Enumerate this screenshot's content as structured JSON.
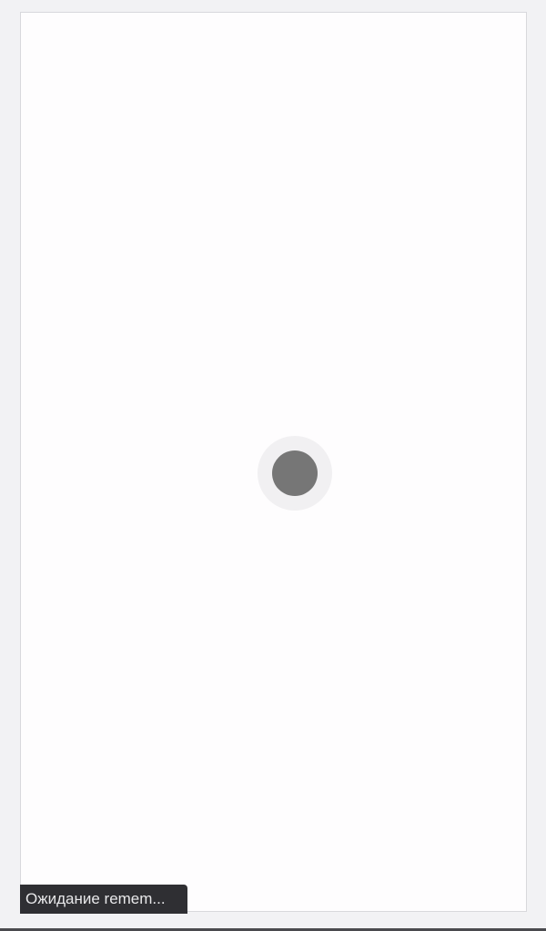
{
  "status_bar": {
    "text": "Ожидание remem..."
  },
  "loading": {
    "spinner_icon": "loading-spinner-icon"
  },
  "colors": {
    "page_background": "#fefdfe",
    "frame_background": "#f2f2f4",
    "spinner_ring": "#f1f0f2",
    "spinner_dot": "#767676",
    "status_bar_background": "#2f2f33",
    "status_bar_text": "#e8e8ea"
  }
}
